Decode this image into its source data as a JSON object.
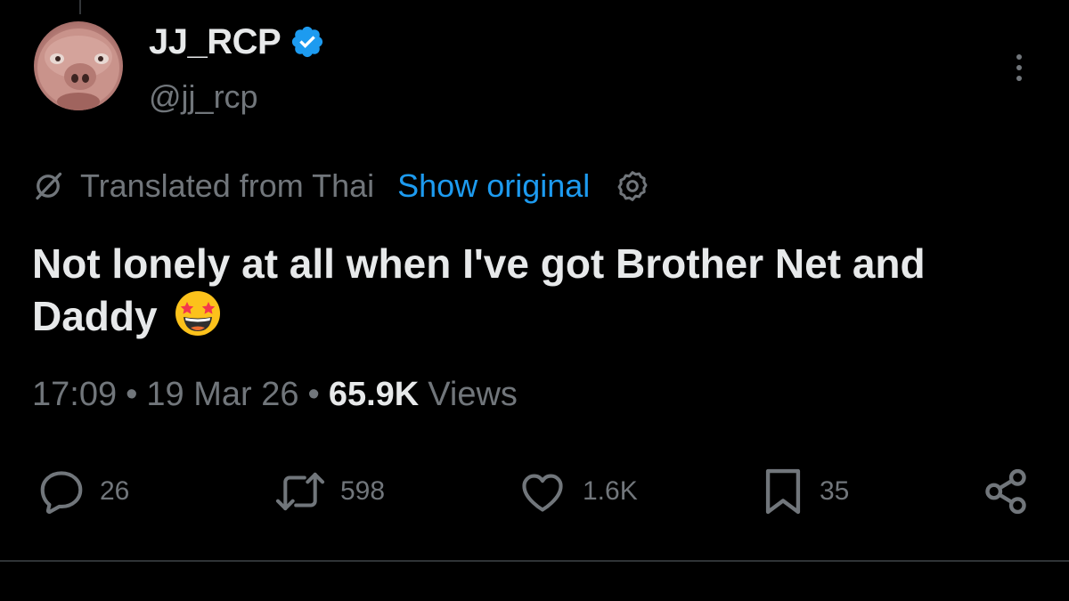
{
  "post": {
    "author": {
      "display_name": "JJ_RCP",
      "handle": "@jj_rcp",
      "verified": true
    },
    "translation": {
      "label": "Translated from Thai",
      "show_original": "Show original"
    },
    "text": "Not lonely at all when I've got Brother Net and Daddy",
    "emoji": "star-struck",
    "time": "17:09",
    "separator": "•",
    "date": "19 Mar 26",
    "views_count": "65.9K",
    "views_label": "Views"
  },
  "actions": {
    "replies": "26",
    "reposts": "598",
    "likes": "1.6K",
    "bookmarks": "35"
  },
  "colors": {
    "background": "#000000",
    "text_primary": "#e7e9ea",
    "text_secondary": "#71767b",
    "accent": "#1d9bf0",
    "divider": "#2f3336"
  },
  "icons": {
    "verified": "verified-badge-icon",
    "more": "more-dots-icon",
    "translate": "translate-slash-icon",
    "settings": "gear-icon",
    "reply": "speech-bubble-icon",
    "repost": "repost-arrows-icon",
    "like": "heart-icon",
    "bookmark": "bookmark-icon",
    "share": "share-nodes-icon"
  }
}
